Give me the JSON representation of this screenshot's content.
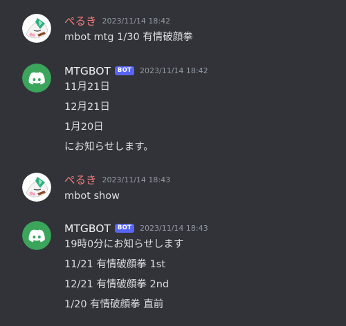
{
  "colors": {
    "background": "#313338",
    "user_name": "#f47b7b",
    "bot_name": "#f2f3f5",
    "bot_badge": "#5865f2",
    "discord_avatar": "#3ba55c",
    "timestamp": "#949ba4",
    "text": "#dbdee1"
  },
  "messages": [
    {
      "author": "ぺるき",
      "avatar_icon": "user-illustration-avatar-icon",
      "timestamp": "2023/11/14 18:42",
      "lines": [
        "mbot mtg 1/30 有情破顔拳"
      ]
    },
    {
      "author": "MTGBOT",
      "badge": "BOT",
      "avatar_icon": "discord-logo-icon",
      "timestamp": "2023/11/14 18:42",
      "lines": [
        "11月21日",
        "12月21日",
        "1月20日",
        "にお知らせします。"
      ]
    },
    {
      "author": "ぺるき",
      "avatar_icon": "user-illustration-avatar-icon",
      "timestamp": "2023/11/14 18:43",
      "lines": [
        "mbot show"
      ]
    },
    {
      "author": "MTGBOT",
      "badge": "BOT",
      "avatar_icon": "discord-logo-icon",
      "timestamp": "2023/11/14 18:43",
      "lines": [
        "19時0分にお知らせします",
        "11/21 有情破顔拳 1st",
        "12/21 有情破顔拳 2nd",
        "1/20 有情破顔拳 直前"
      ]
    }
  ]
}
